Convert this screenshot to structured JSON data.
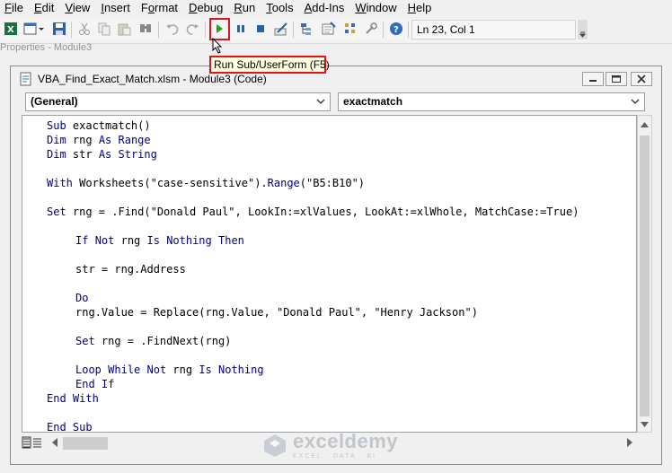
{
  "menu": [
    "File",
    "Edit",
    "View",
    "Insert",
    "Format",
    "Debug",
    "Run",
    "Tools",
    "Add-Ins",
    "Window",
    "Help"
  ],
  "menu_mnemonic": [
    "F",
    "E",
    "V",
    "I",
    "o",
    "D",
    "R",
    "T",
    "A",
    "W",
    "H"
  ],
  "toolbar": {
    "status": "Ln 23, Col 1",
    "run_tooltip": "Run Sub/UserForm (F5)",
    "ghost_text": "Properties - Module3"
  },
  "window": {
    "title": "VBA_Find_Exact_Match.xlsm - Module3 (Code)",
    "object_combo": "(General)",
    "proc_combo": "exactmatch"
  },
  "code": [
    {
      "indent": 0,
      "text": "Sub exactmatch()"
    },
    {
      "indent": 0,
      "text": "Dim rng As Range"
    },
    {
      "indent": 0,
      "text": "Dim str As String"
    },
    {
      "indent": 0,
      "text": ""
    },
    {
      "indent": 0,
      "text": "With Worksheets(\"case-sensitive\").Range(\"B5:B10\")"
    },
    {
      "indent": 0,
      "text": ""
    },
    {
      "indent": 0,
      "text": "Set rng = .Find(\"Donald Paul\", LookIn:=xlValues, LookAt:=xlWhole, MatchCase:=True)"
    },
    {
      "indent": 0,
      "text": ""
    },
    {
      "indent": 1,
      "text": "If Not rng Is Nothing Then"
    },
    {
      "indent": 0,
      "text": ""
    },
    {
      "indent": 1,
      "text": "str = rng.Address"
    },
    {
      "indent": 0,
      "text": ""
    },
    {
      "indent": 1,
      "text": "Do"
    },
    {
      "indent": 1,
      "text": "rng.Value = Replace(rng.Value, \"Donald Paul\", \"Henry Jackson\")"
    },
    {
      "indent": 0,
      "text": ""
    },
    {
      "indent": 1,
      "text": "Set rng = .FindNext(rng)"
    },
    {
      "indent": 0,
      "text": ""
    },
    {
      "indent": 1,
      "text": "Loop While Not rng Is Nothing"
    },
    {
      "indent": 1,
      "text": "End If"
    },
    {
      "indent": 0,
      "text": "End With"
    },
    {
      "indent": 0,
      "text": ""
    },
    {
      "indent": 0,
      "text": "End Sub"
    }
  ],
  "keywords": [
    "Sub",
    "Dim",
    "As",
    "Range",
    "String",
    "With",
    "Set",
    "If",
    "Not",
    "Is",
    "Nothing",
    "Then",
    "Do",
    "Loop",
    "While",
    "End"
  ],
  "watermark": {
    "brand": "exceldemy",
    "tagline": "EXCEL · DATA · BI"
  },
  "colors": {
    "keyword": "#00008b",
    "highlight": "#e0141e",
    "tooltip_bg": "#ffffe1",
    "run_green": "#1aa51a"
  }
}
